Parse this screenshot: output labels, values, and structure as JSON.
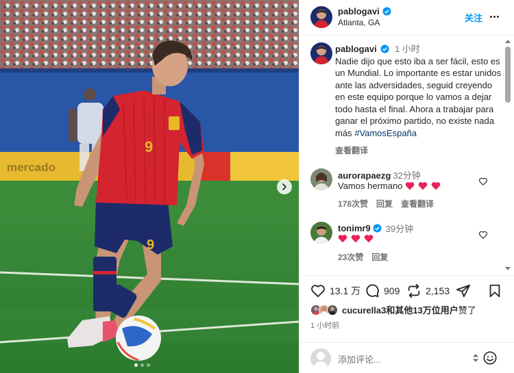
{
  "post": {
    "author": "pablogavi",
    "location": "Atlanta, GA",
    "follow_label": "关注",
    "caption_time": "1 小时",
    "caption_text": "Nadie dijo que esto iba a ser fácil, esto es un Mundial. Lo importante es estar unidos ante las adversidades, seguid creyendo en este equipo porque lo vamos a dejar todo hasta el final. Ahora a trabajar para ganar el próximo partido, no existe nada más",
    "hashtag": "#VamosEspaña",
    "see_translation": "查看翻译",
    "carousel": {
      "count": 3,
      "active": 0
    },
    "photo_texts": {
      "jersey_number": "9",
      "ad_board": "mercado"
    }
  },
  "comments": [
    {
      "user": "aurorapaezg",
      "time": "32分钟",
      "text": "Vamos hermano",
      "hearts": 3,
      "likes": "178次赞",
      "reply": "回复",
      "translate": "查看翻译",
      "verified": false
    },
    {
      "user": "tonimr9",
      "time": "39分钟",
      "text": "",
      "hearts": 3,
      "likes": "23次赞",
      "reply": "回复",
      "verified": true
    }
  ],
  "actions": {
    "like_count": "13.1 万",
    "comment_count": "909",
    "share_count": "2,153"
  },
  "likers": {
    "prefix": "cucurella3和",
    "rest": "其他13万位用户",
    "suffix": "赞了"
  },
  "posted_ago": "1 小时前",
  "composer": {
    "placeholder": "添加评论..."
  },
  "colors": {
    "accent": "#0095f6",
    "heart_emoji": "#e8235a",
    "hashtag": "#00376b",
    "spain_red": "#d4242f",
    "spain_navy": "#1d2b6b"
  },
  "icons": [
    "verified-badge-icon",
    "more-icon",
    "chevron-right-icon",
    "heart-icon",
    "comment-icon",
    "repost-icon",
    "share-icon",
    "bookmark-icon",
    "emoji-icon",
    "sort-icon"
  ]
}
